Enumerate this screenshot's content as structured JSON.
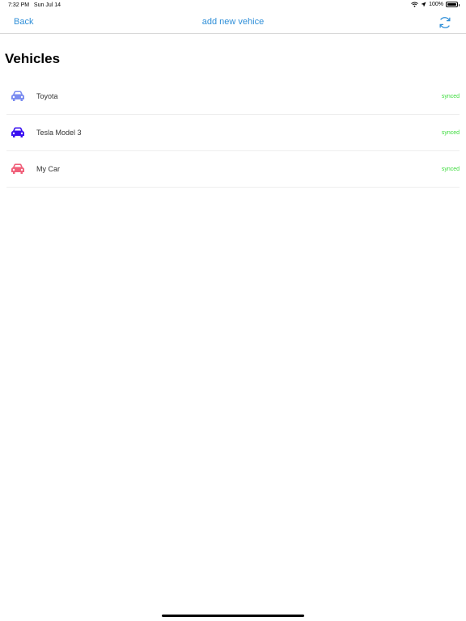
{
  "status_bar": {
    "time": "7:32 PM",
    "date": "Sun Jul 14",
    "battery": "100%"
  },
  "nav": {
    "back_label": "Back",
    "title": "add new vehice",
    "refresh_icon": "refresh-icon"
  },
  "page": {
    "title": "Vehicles"
  },
  "vehicles": [
    {
      "name": "Toyota",
      "status": "synced",
      "color": "#7b8cf0"
    },
    {
      "name": "Tesla Model 3",
      "status": "synced",
      "color": "#3a10f0"
    },
    {
      "name": "My Car",
      "status": "synced",
      "color": "#f0607a"
    }
  ],
  "colors": {
    "accent": "#2f8fd8",
    "synced": "#3adb3a"
  }
}
